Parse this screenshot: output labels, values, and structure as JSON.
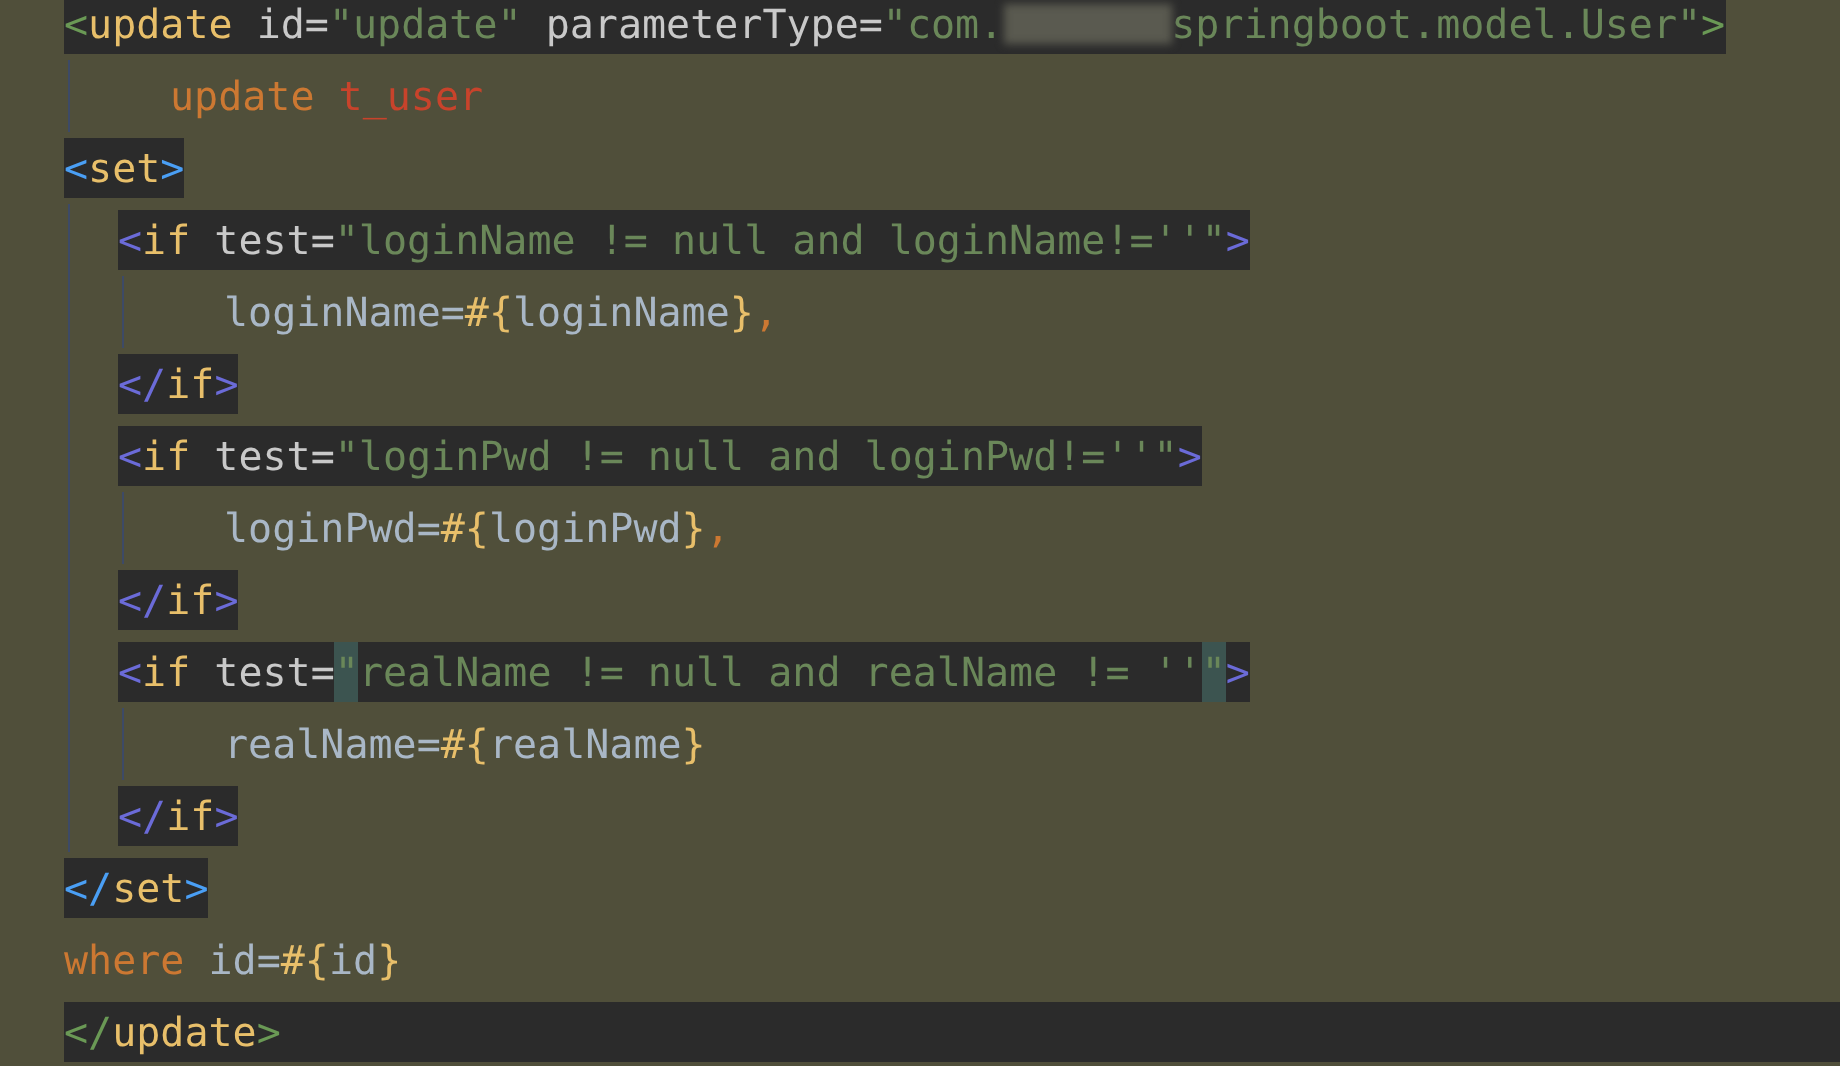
{
  "lines": [
    {
      "highlighted": true,
      "current": false,
      "tokens": [
        {
          "kind": "rootbracket",
          "text": "<"
        },
        {
          "kind": "tag",
          "text": "update"
        },
        {
          "kind": "attr",
          "text": " id="
        },
        {
          "kind": "string",
          "text": "\"update\""
        },
        {
          "kind": "attr",
          "text": " parameterType="
        },
        {
          "kind": "string",
          "text": "\"com."
        },
        {
          "kind": "redacted"
        },
        {
          "kind": "string",
          "text": "springboot.model.User\""
        },
        {
          "kind": "rootbracket",
          "text": ">"
        }
      ],
      "children": [
        {
          "highlighted": false,
          "current": false,
          "tokens": [
            {
              "kind": "keyword",
              "text": "update"
            },
            {
              "kind": "table",
              "text": " t_user"
            }
          ]
        }
      ]
    },
    {
      "highlighted": true,
      "current": false,
      "tokens": [
        {
          "kind": "setbracket",
          "text": "<"
        },
        {
          "kind": "tag",
          "text": "set"
        },
        {
          "kind": "setbracket",
          "text": ">"
        }
      ],
      "children": [
        {
          "highlighted": true,
          "current": false,
          "tokens": [
            {
              "kind": "ifbracket",
              "text": "<"
            },
            {
              "kind": "tag",
              "text": "if"
            },
            {
              "kind": "attr",
              "text": " test="
            },
            {
              "kind": "string",
              "text": "\"loginName != null and loginName!=''\""
            },
            {
              "kind": "ifbracket",
              "text": ">"
            }
          ],
          "children": [
            {
              "highlighted": false,
              "current": false,
              "tokens": [
                {
                  "kind": "text",
                  "text": "loginName="
                },
                {
                  "kind": "brace",
                  "text": "#{"
                },
                {
                  "kind": "text",
                  "text": "loginName"
                },
                {
                  "kind": "brace",
                  "text": "}"
                },
                {
                  "kind": "comma",
                  "text": ","
                }
              ]
            }
          ]
        },
        {
          "highlighted": true,
          "current": false,
          "tokens": [
            {
              "kind": "ifbracket",
              "text": "</"
            },
            {
              "kind": "tag",
              "text": "if"
            },
            {
              "kind": "ifbracket",
              "text": ">"
            }
          ]
        },
        {
          "highlighted": true,
          "current": false,
          "tokens": [
            {
              "kind": "ifbracket",
              "text": "<"
            },
            {
              "kind": "tag",
              "text": "if"
            },
            {
              "kind": "attr",
              "text": " test="
            },
            {
              "kind": "string",
              "text": "\"loginPwd != null and loginPwd!=''\""
            },
            {
              "kind": "ifbracket",
              "text": ">"
            }
          ],
          "children": [
            {
              "highlighted": false,
              "current": false,
              "tokens": [
                {
                  "kind": "text",
                  "text": "loginPwd="
                },
                {
                  "kind": "brace",
                  "text": "#{"
                },
                {
                  "kind": "text",
                  "text": "loginPwd"
                },
                {
                  "kind": "brace",
                  "text": "}"
                },
                {
                  "kind": "comma",
                  "text": ","
                }
              ]
            }
          ]
        },
        {
          "highlighted": true,
          "current": false,
          "tokens": [
            {
              "kind": "ifbracket",
              "text": "</"
            },
            {
              "kind": "tag",
              "text": "if"
            },
            {
              "kind": "ifbracket",
              "text": ">"
            }
          ]
        },
        {
          "highlighted": true,
          "current": false,
          "tokens": [
            {
              "kind": "ifbracket",
              "text": "<"
            },
            {
              "kind": "tag",
              "text": "if"
            },
            {
              "kind": "attr",
              "text": " test="
            },
            {
              "kind": "match",
              "text": "\""
            },
            {
              "kind": "string",
              "text": "realName != null and realName != ''"
            },
            {
              "kind": "match",
              "text": "\""
            },
            {
              "kind": "ifbracket",
              "text": ">"
            }
          ],
          "children": [
            {
              "highlighted": false,
              "current": false,
              "tokens": [
                {
                  "kind": "text",
                  "text": "realName="
                },
                {
                  "kind": "brace",
                  "text": "#{"
                },
                {
                  "kind": "text",
                  "text": "realName"
                },
                {
                  "kind": "brace",
                  "text": "}"
                }
              ]
            }
          ]
        },
        {
          "highlighted": true,
          "current": false,
          "tokens": [
            {
              "kind": "ifbracket",
              "text": "</"
            },
            {
              "kind": "tag",
              "text": "if"
            },
            {
              "kind": "ifbracket",
              "text": ">"
            }
          ]
        }
      ]
    },
    {
      "highlighted": true,
      "current": false,
      "tokens": [
        {
          "kind": "setbracket",
          "text": "</"
        },
        {
          "kind": "tag",
          "text": "set"
        },
        {
          "kind": "setbracket",
          "text": ">"
        }
      ]
    },
    {
      "highlighted": false,
      "current": false,
      "tokens": [
        {
          "kind": "keyword",
          "text": "where"
        },
        {
          "kind": "text",
          "text": " id="
        },
        {
          "kind": "brace",
          "text": "#{"
        },
        {
          "kind": "text",
          "text": "id"
        },
        {
          "kind": "brace",
          "text": "}"
        }
      ]
    },
    {
      "highlighted": true,
      "current": true,
      "tokens": [
        {
          "kind": "rootbracket",
          "text": "</"
        },
        {
          "kind": "tag",
          "text": "update"
        },
        {
          "kind": "rootbracket",
          "text": ">"
        }
      ]
    }
  ]
}
